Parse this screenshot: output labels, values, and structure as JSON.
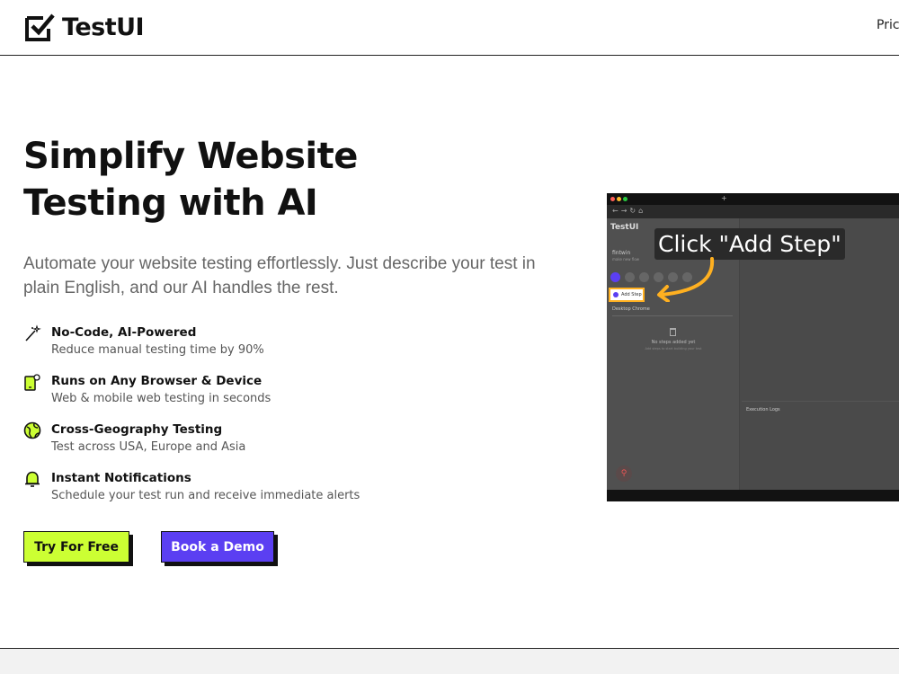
{
  "header": {
    "logo_text": "TestUI",
    "nav_partial": "Prici"
  },
  "hero": {
    "title_line1": "Simplify Website",
    "title_line2": "Testing with AI",
    "subtitle": "Automate your website testing effortlessly. Just describe your test in plain English, and our AI handles the rest."
  },
  "features": [
    {
      "icon": "magic-wand-icon",
      "title": "No-Code, AI-Powered",
      "desc": "Reduce manual testing time by 90%"
    },
    {
      "icon": "device-gear-icon",
      "title": "Runs on Any Browser & Device",
      "desc": "Web & mobile web testing in seconds"
    },
    {
      "icon": "globe-icon",
      "title": "Cross-Geography Testing",
      "desc": "Test across USA, Europe and Asia"
    },
    {
      "icon": "bell-icon",
      "title": "Instant Notifications",
      "desc": "Schedule your test run and receive immediate alerts"
    }
  ],
  "cta": {
    "primary_label": "Try For Free",
    "secondary_label": "Book a Demo"
  },
  "demo": {
    "callout": "Click \"Add Step\"",
    "mini_logo": "TestUI",
    "project_name": "fintwin",
    "project_sub": "make new flow",
    "add_step_label": "Add Step",
    "browser_select": "Desktop Chrome",
    "empty_title": "No steps added yet",
    "empty_sub": "Add steps to start building your test",
    "logs_label": "Execution Logs"
  },
  "colors": {
    "accent_lime": "#ccff33",
    "accent_purple": "#5b3ff2",
    "highlight_orange": "#ffb020"
  }
}
